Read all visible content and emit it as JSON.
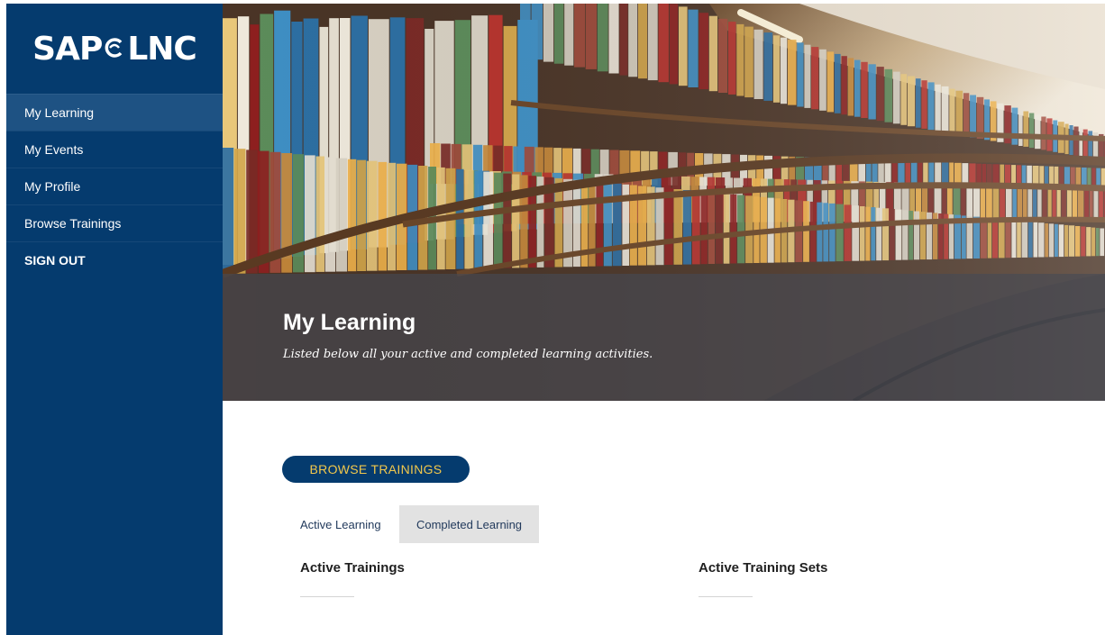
{
  "brand": {
    "logo_text_left": "SAP",
    "logo_text_right": "LNC"
  },
  "sidebar": {
    "items": [
      {
        "label": "My Learning",
        "active": true
      },
      {
        "label": "My Events"
      },
      {
        "label": "My Profile"
      },
      {
        "label": "Browse Trainings"
      },
      {
        "label": "SIGN OUT"
      }
    ]
  },
  "hero": {
    "title": "My Learning",
    "subtitle": "Listed below all your active and completed learning activities."
  },
  "actions": {
    "browse_label": "BROWSE TRAININGS"
  },
  "tabs": [
    {
      "label": "Active Learning",
      "selected": true
    },
    {
      "label": "Completed Learning",
      "selected": false
    }
  ],
  "sections": {
    "active_trainings": "Active Trainings",
    "active_training_sets": "Active Training Sets"
  },
  "colors": {
    "sidebar": "#053b6e",
    "sidebar_active": "#1e5283",
    "button_text": "#f2c84b",
    "tab_inactive_bg": "#e2e2e2"
  }
}
